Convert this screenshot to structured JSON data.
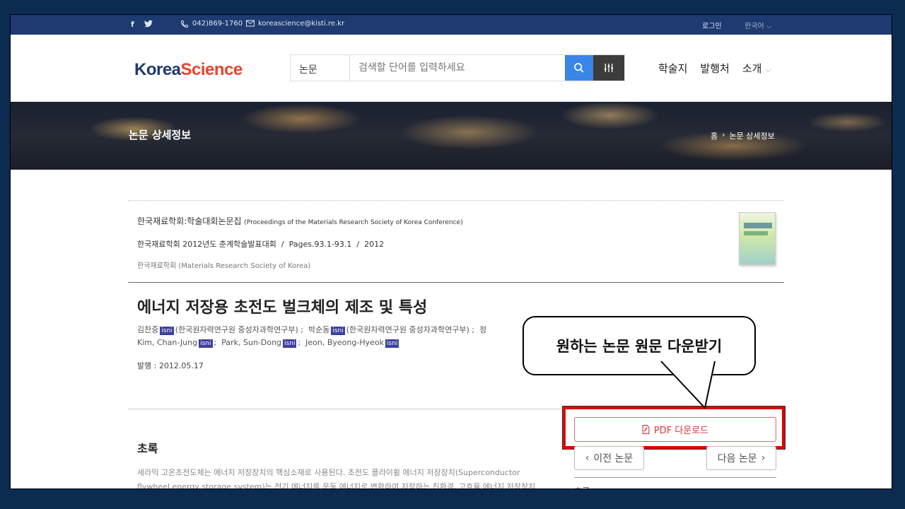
{
  "topbar": {
    "phone": "042)869-1760",
    "email": "koreascience@kisti.re.kr",
    "login": "로그인",
    "language": "한국어"
  },
  "header": {
    "logo_part1": "Korea",
    "logo_part2": "Science",
    "search_category": "논문",
    "search_placeholder": "검색할 단어를 입력하세요",
    "nav": [
      "학술지",
      "발행처",
      "소개"
    ]
  },
  "banner": {
    "title": "논문 상세정보",
    "breadcrumb": [
      "홈",
      "논문 상세정보"
    ]
  },
  "paper": {
    "journal_ko": "한국재료학회:학술대회논문집",
    "journal_en": "(Proceedings of the Materials Research Society of Korea Conference)",
    "event": "한국재료학회 2012년도 춘계학술발표대회",
    "pages": "Pages.93.1-93.1",
    "year": "2012",
    "publisher": "한국재료학회 (Materials Research Society of Korea)",
    "title": "에너지 저장용 초전도 벌크체의 제조 및 특성",
    "authors_ko": [
      {
        "name": "김찬중",
        "affil": "(한국원자력연구원 중성자과학연구부)"
      },
      {
        "name": "박순동",
        "affil": "(한국원자력연구원 중성자과학연구부)"
      }
    ],
    "authors_ko_tail": "정",
    "authors_en": [
      "Kim, Chan-Jung",
      "Park, Sun-Dong",
      "Jeon, Byeong-Hyeok"
    ],
    "isni_label": "isni",
    "published": "발행 : 2012.05.17"
  },
  "abstract": {
    "heading": "초록",
    "text_line1": "세라믹 고온초전도체는 에너지 저장장치의 핵심소재로 사용된다. 초전도 플라이휠 에너지 저장장치(Superconductor",
    "text_line2": "flywheel energy storage system)는 전기 에너지를 운동 에너지로 변환하여 저장하는 친환경, 고효율 에너지 저장장치"
  },
  "actions": {
    "pdf_label": "PDF 다운로드",
    "prev_label": "이전 논문",
    "next_label": "다음 논문",
    "side_abstract": "초록"
  },
  "callout": {
    "text": "원하는 논문 원문 다운받기"
  },
  "colors": {
    "topbar": "#1e3a70",
    "logo_blue": "#1e3a70",
    "logo_red": "#e8432e",
    "search_button": "#3a86e8",
    "highlight_border": "#e00000",
    "pdf_text": "#d9363e",
    "page_background": "#0b2b50"
  }
}
